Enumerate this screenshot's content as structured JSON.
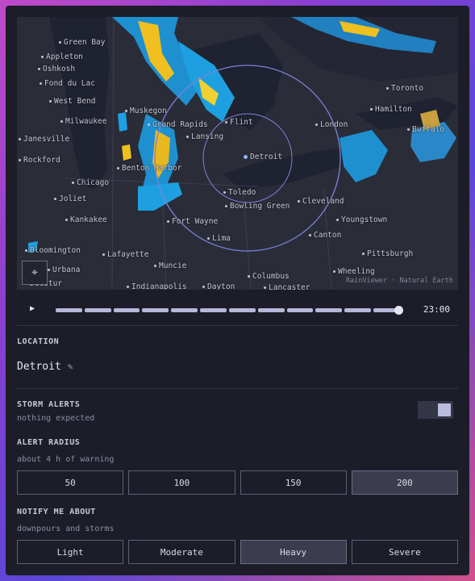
{
  "map": {
    "cities": [
      {
        "name": "Green Bay"
      },
      {
        "name": "Appleton"
      },
      {
        "name": "Oshkosh"
      },
      {
        "name": "Fond du Lac"
      },
      {
        "name": "West Bend"
      },
      {
        "name": "Milwaukee"
      },
      {
        "name": "Janesville"
      },
      {
        "name": "Rockford"
      },
      {
        "name": "Chicago"
      },
      {
        "name": "Joliet"
      },
      {
        "name": "Kankakee"
      },
      {
        "name": "Bloomington"
      },
      {
        "name": "Urbana"
      },
      {
        "name": "Decatur"
      },
      {
        "name": "Lafayette"
      },
      {
        "name": "Muncie"
      },
      {
        "name": "Indianapolis"
      },
      {
        "name": "Dayton"
      },
      {
        "name": "Fort Wayne"
      },
      {
        "name": "Lima"
      },
      {
        "name": "Columbus"
      },
      {
        "name": "Lancaster"
      },
      {
        "name": "Muskegon"
      },
      {
        "name": "Grand Rapids"
      },
      {
        "name": "Lansing"
      },
      {
        "name": "Flint"
      },
      {
        "name": "Benton Harbor"
      },
      {
        "name": "Toledo"
      },
      {
        "name": "Bowling Green"
      },
      {
        "name": "Detroit"
      },
      {
        "name": "London"
      },
      {
        "name": "Cleveland"
      },
      {
        "name": "Youngstown"
      },
      {
        "name": "Canton"
      },
      {
        "name": "Pittsburgh"
      },
      {
        "name": "Wheeling"
      },
      {
        "name": "Toronto"
      },
      {
        "name": "Hamilton"
      },
      {
        "name": "Buffalo"
      }
    ],
    "attribution": "RainViewer · Natural Earth",
    "locate_icon": "crosshair-icon"
  },
  "timeline": {
    "play_icon": "play-icon",
    "time": "23:00",
    "position": 1.0
  },
  "location": {
    "label": "LOCATION",
    "value": "Detroit",
    "edit_icon": "pencil-icon"
  },
  "storm_alerts": {
    "label": "STORM ALERTS",
    "sub": "nothing expected",
    "enabled": true
  },
  "alert_radius": {
    "label": "ALERT RADIUS",
    "sub": "about 4 h of warning",
    "options": [
      "50",
      "100",
      "150",
      "200"
    ],
    "selected": "200"
  },
  "notify": {
    "label": "NOTIFY ME ABOUT",
    "sub": "downpours and storms",
    "options": [
      "Light",
      "Moderate",
      "Heavy",
      "Severe"
    ],
    "selected": "Heavy"
  },
  "colors": {
    "accent": "#b9bcdc",
    "radar_light": "#2aa8e0",
    "radar_heavy": "#f0c020"
  }
}
